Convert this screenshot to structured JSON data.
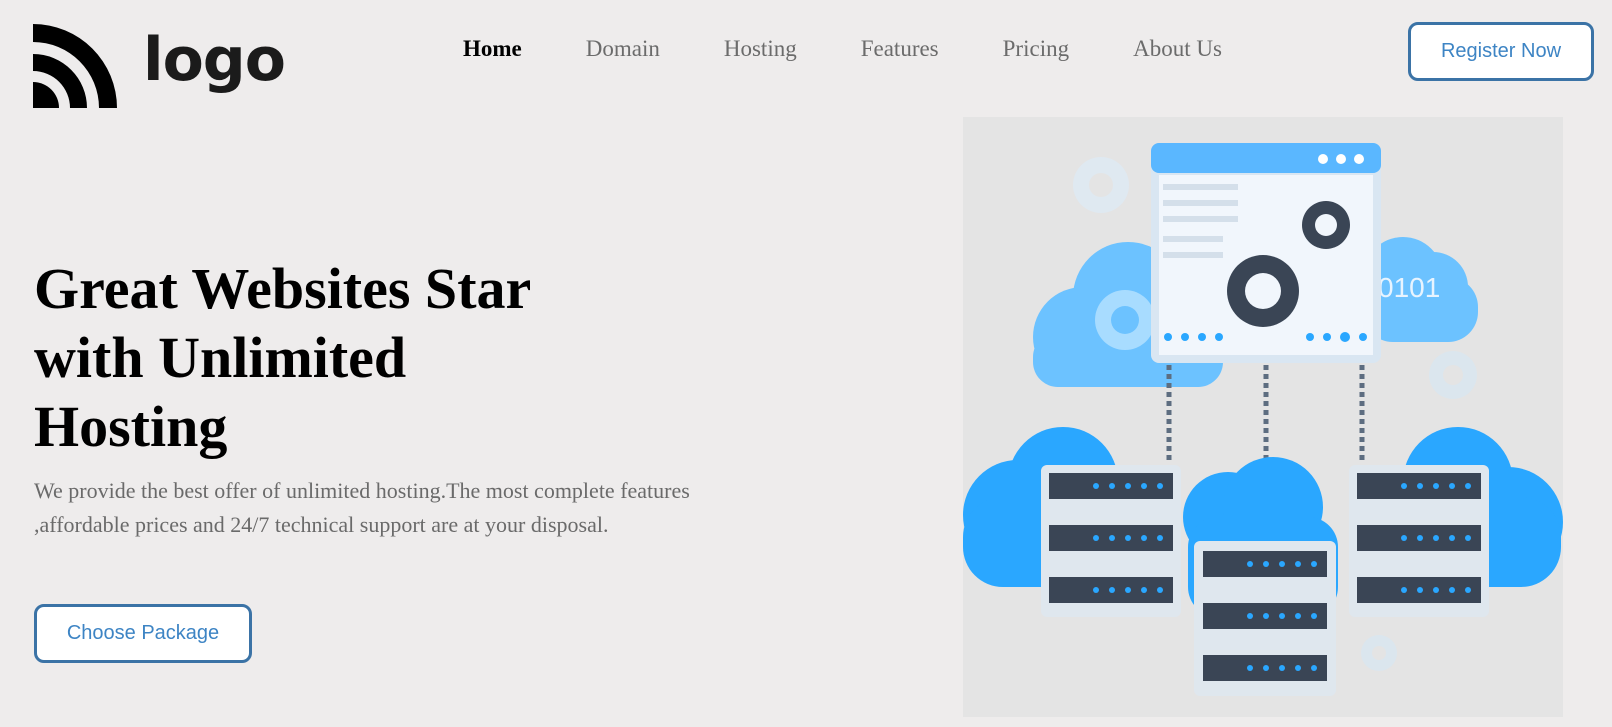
{
  "header": {
    "logo_text": "logo",
    "register_label": "Register Now"
  },
  "nav": {
    "items": [
      {
        "label": "Home",
        "active": true
      },
      {
        "label": "Domain",
        "active": false
      },
      {
        "label": "Hosting",
        "active": false
      },
      {
        "label": "Features",
        "active": false
      },
      {
        "label": "Pricing",
        "active": false
      },
      {
        "label": "About Us",
        "active": false
      }
    ]
  },
  "hero": {
    "title_line1": "Great Websites Star",
    "title_line2": "with Unlimited",
    "title_line3": "Hosting",
    "description": "We provide the best offer of unlimited hosting.The most complete features ,affordable prices and 24/7 technical support are at your disposal.",
    "cta_label": "Choose Package",
    "illustration_binary_text": "0101"
  },
  "colors": {
    "background": "#eeecec",
    "accent": "#3d84c4",
    "button_border": "#3b73a6",
    "cloud_blue": "#2aa7ff",
    "dark_server": "#3a4555"
  }
}
